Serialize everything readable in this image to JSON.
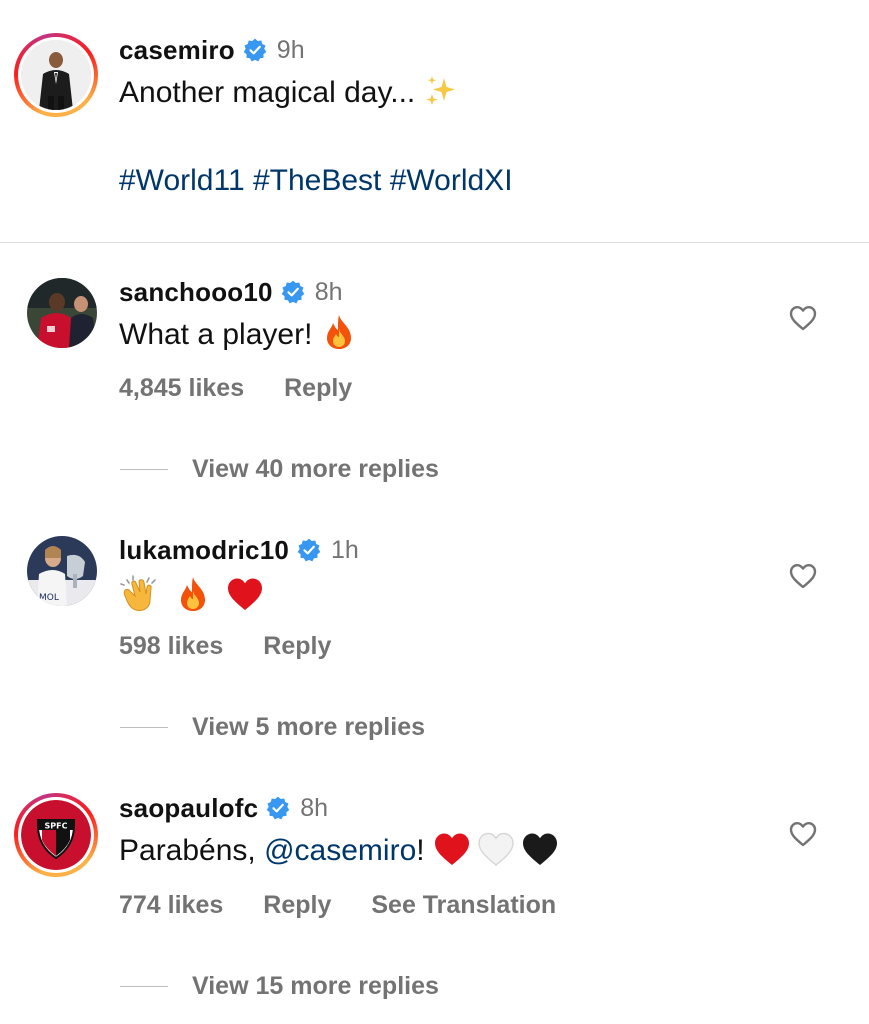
{
  "caption": {
    "username": "casemiro",
    "time": "9h",
    "text": "Another magical day... ",
    "hashtags": "#World11 #TheBest #WorldXI"
  },
  "comments": [
    {
      "username": "sanchooo10",
      "time": "8h",
      "text": "What a player! ",
      "likes": "4,845 likes",
      "reply_label": "Reply",
      "view_replies": "View 40 more replies"
    },
    {
      "username": "lukamodric10",
      "time": "1h",
      "likes": "598 likes",
      "reply_label": "Reply",
      "view_replies": "View 5 more replies"
    },
    {
      "username": "saopaulofc",
      "time": "8h",
      "text_before": "Parabéns, ",
      "mention": "@casemiro",
      "text_after": "! ",
      "likes": "774 likes",
      "reply_label": "Reply",
      "translate_label": "See Translation",
      "view_replies": "View 15 more replies",
      "badge_text": "SPFC"
    }
  ],
  "colors": {
    "verified": "#3897f0",
    "hashtag": "#00376b",
    "muted": "#737373",
    "divider": "#dbdbdb"
  },
  "icons": {
    "verified": "verified-badge-icon",
    "heart": "heart-outline-icon"
  }
}
